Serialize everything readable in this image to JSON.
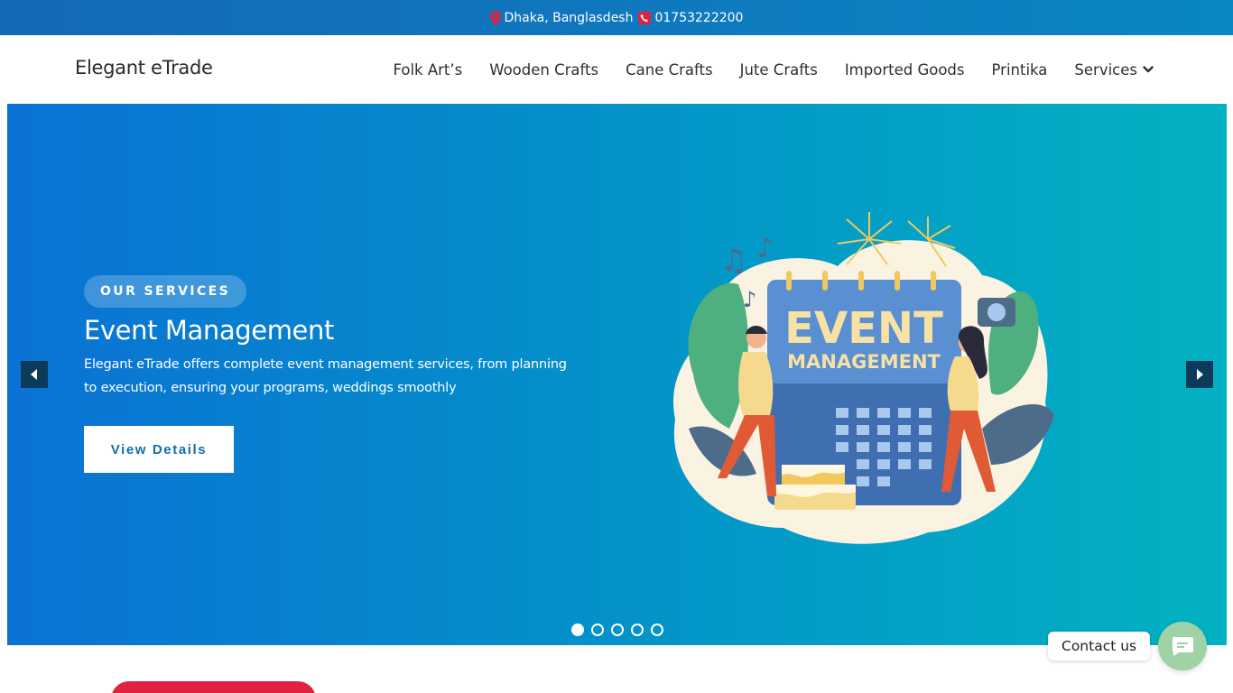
{
  "topbar": {
    "location": "Dhaka, Banglasdesh",
    "phone": "01753222200"
  },
  "navbar": {
    "brand": "Elegant eTrade",
    "menu": [
      {
        "label": "Folk Art’s"
      },
      {
        "label": "Wooden Crafts"
      },
      {
        "label": "Cane Crafts"
      },
      {
        "label": "Jute Crafts"
      },
      {
        "label": "Imported Goods"
      },
      {
        "label": "Printika"
      },
      {
        "label": "Services"
      }
    ]
  },
  "hero": {
    "badge": "OUR SERVICES",
    "title": "Event Management",
    "description": "Elegant eTrade offers complete event management services, from planning to execution, ensuring your programs, weddings smoothly",
    "button_label": "View Details",
    "slides_total": 5,
    "active_slide": 1,
    "illustration": {
      "line1": "EVENT",
      "line2": "MANAGEMENT"
    }
  },
  "contact_widget": {
    "label": "Contact us"
  },
  "colors": {
    "topbar": "#0a7ac0",
    "hero_start": "#0b72d4",
    "hero_end": "#03b2c2",
    "button_text": "#0d6fb0",
    "fab": "#9fd2a5",
    "accent_red": "#e0213f"
  }
}
